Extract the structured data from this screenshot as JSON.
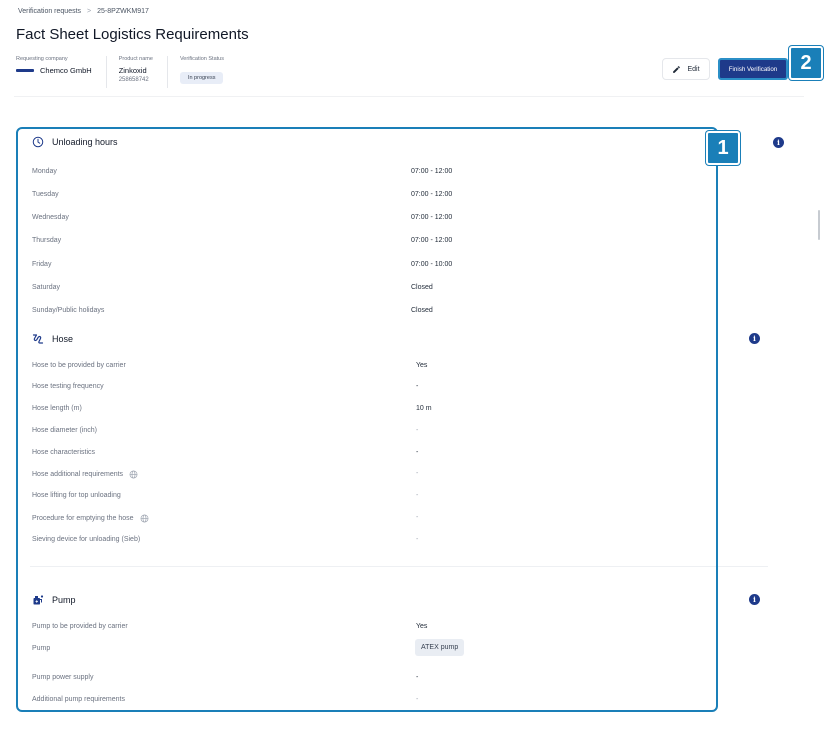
{
  "breadcrumb": {
    "parent": "Verification requests",
    "separator": ">",
    "current": "25-8PZWKM917"
  },
  "title": "Fact Sheet Logistics Requirements",
  "meta": {
    "company_label": "Requesting company",
    "company_name": "Chemco GmbH",
    "product_label": "Product name",
    "product_name": "Zinkoxid",
    "product_id": "258658742",
    "status_label": "Verification Status",
    "status_value": "In progress"
  },
  "actions": {
    "edit_label": "Edit",
    "finish_label": "Finish Verification"
  },
  "callouts": {
    "one": "1",
    "two": "2"
  },
  "unloading": {
    "title": "Unloading hours",
    "rows": [
      {
        "label": "Monday",
        "value": "07:00 - 12:00"
      },
      {
        "label": "Tuesday",
        "value": "07:00 - 12:00"
      },
      {
        "label": "Wednesday",
        "value": "07:00 - 12:00"
      },
      {
        "label": "Thursday",
        "value": "07:00 - 12:00"
      },
      {
        "label": "Friday",
        "value": "07:00 - 10:00"
      },
      {
        "label": "Saturday",
        "value": "Closed"
      },
      {
        "label": "Sunday/Public holidays",
        "value": "Closed"
      }
    ]
  },
  "hose": {
    "title": "Hose",
    "rows": [
      {
        "label": "Hose to be provided by carrier",
        "value": "Yes"
      },
      {
        "label": "Hose testing frequency",
        "value": "-"
      },
      {
        "label": "Hose length (m)",
        "value": "10 m"
      },
      {
        "label": "Hose diameter (inch)",
        "value": "-"
      },
      {
        "label": "Hose characteristics",
        "value": "-"
      },
      {
        "label": "Hose additional requirements",
        "value": "-"
      },
      {
        "label": "Hose lifting for top unloading",
        "value": "-"
      },
      {
        "label": "Procedure for emptying the hose",
        "value": "-"
      },
      {
        "label": "Sieving device for unloading (Sieb)",
        "value": "-"
      }
    ]
  },
  "pump": {
    "title": "Pump",
    "rows": [
      {
        "label": "Pump to be provided by carrier",
        "value": "Yes"
      },
      {
        "label": "Pump",
        "value": "ATEX pump"
      },
      {
        "label": "Pump power supply",
        "value": "-"
      },
      {
        "label": "Additional pump requirements",
        "value": "-"
      }
    ]
  },
  "icons": {
    "info": "i",
    "globe": "globe-icon",
    "clock": "clock-icon",
    "hose": "hose-icon",
    "pump": "pump-icon",
    "pencil": "pencil-icon"
  },
  "colors": {
    "brand": "#1e3a8a",
    "callout": "#1a7fb8"
  }
}
